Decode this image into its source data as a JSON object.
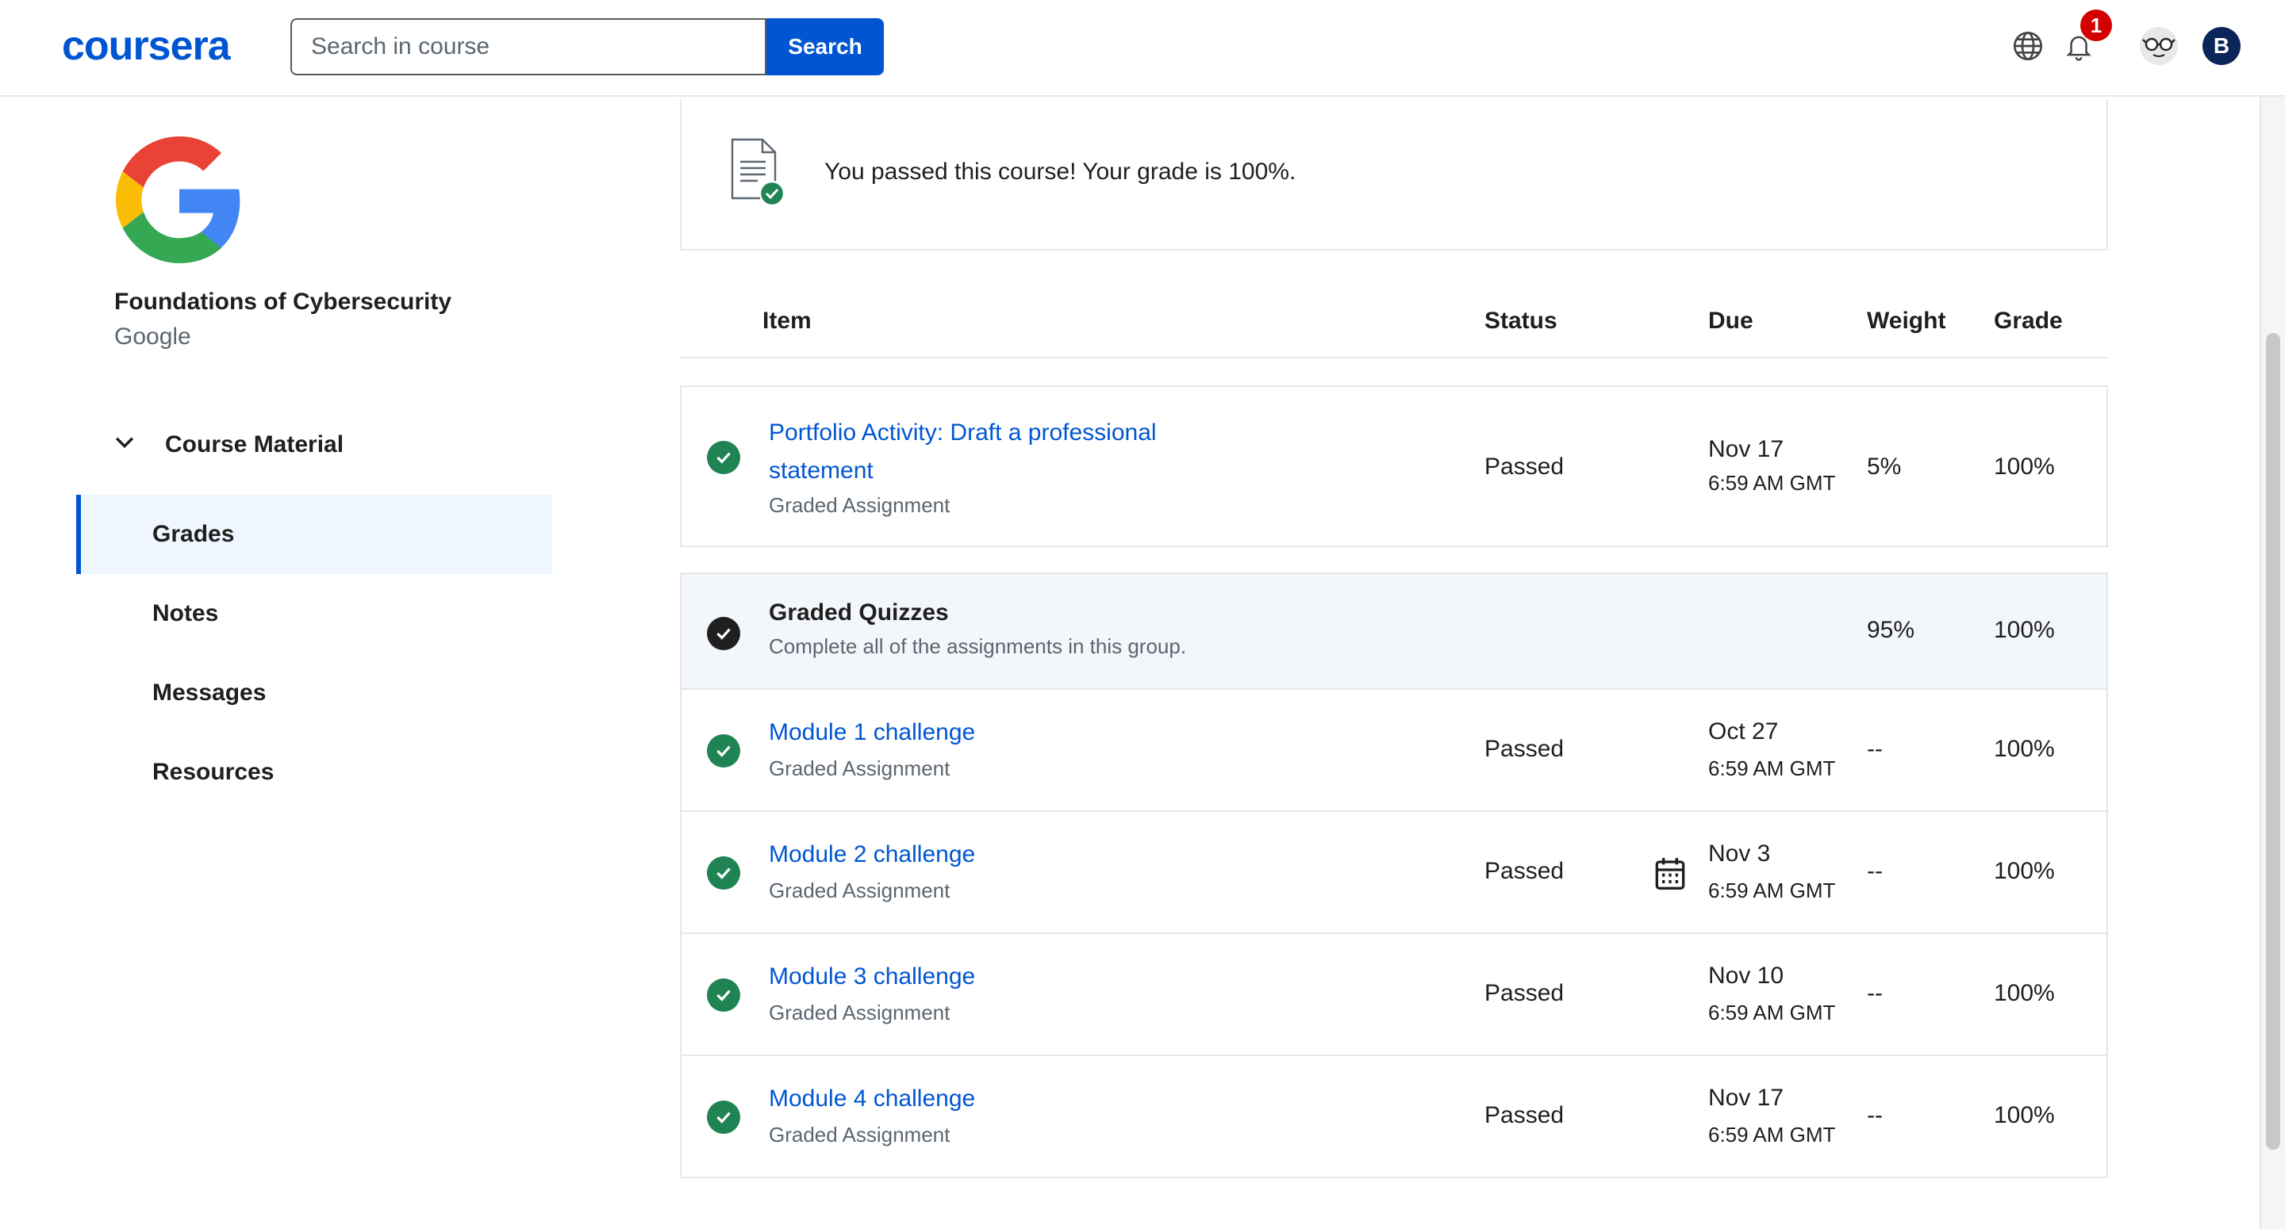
{
  "header": {
    "logo": "coursera",
    "search_placeholder": "Search in course",
    "search_button": "Search",
    "notification_count": "1",
    "avatar_initial": "B"
  },
  "sidebar": {
    "course_title": "Foundations of Cybersecurity",
    "partner": "Google",
    "section_label": "Course Material",
    "items": [
      {
        "label": "Grades",
        "active": true
      },
      {
        "label": "Notes"
      },
      {
        "label": "Messages"
      },
      {
        "label": "Resources"
      }
    ]
  },
  "banner": {
    "text": "You passed this course! Your grade is 100%."
  },
  "table": {
    "headers": {
      "item": "Item",
      "status": "Status",
      "due": "Due",
      "weight": "Weight",
      "grade": "Grade"
    },
    "rows": [
      {
        "title_line1": "Portfolio Activity: Draft a professional",
        "title_line2": "statement",
        "subtitle": "Graded Assignment",
        "status": "Passed",
        "due_date": "Nov 17",
        "due_time": "6:59 AM GMT",
        "weight": "5%",
        "grade": "100%"
      },
      {
        "title": "Graded Quizzes",
        "subtitle": "Complete all of the assignments in this group.",
        "weight": "95%",
        "grade": "100%"
      },
      {
        "title": "Module 1 challenge",
        "subtitle": "Graded Assignment",
        "status": "Passed",
        "due_date": "Oct 27",
        "due_time": "6:59 AM GMT",
        "weight": "--",
        "grade": "100%"
      },
      {
        "title": "Module 2 challenge",
        "subtitle": "Graded Assignment",
        "status": "Passed",
        "due_date": "Nov 3",
        "due_time": "6:59 AM GMT",
        "weight": "--",
        "grade": "100%"
      },
      {
        "title": "Module 3 challenge",
        "subtitle": "Graded Assignment",
        "status": "Passed",
        "due_date": "Nov 10",
        "due_time": "6:59 AM GMT",
        "weight": "--",
        "grade": "100%"
      },
      {
        "title": "Module 4 challenge",
        "subtitle": "Graded Assignment",
        "status": "Passed",
        "due_date": "Nov 17",
        "due_time": "6:59 AM GMT",
        "weight": "--",
        "grade": "100%"
      }
    ]
  },
  "icons": {
    "globe": "globe-icon",
    "bell": "bell-icon",
    "accessibility": "glasses-icon",
    "check": "check-circle-icon",
    "calendar": "calendar-icon",
    "chevron": "chevron-down-icon",
    "document": "document-check-icon"
  },
  "colors": {
    "brand": "#0056d2",
    "success": "#1f8354",
    "badge": "#d30001",
    "group_bg": "#f3f6fa",
    "active_nav_bg": "#f0f6ff"
  }
}
